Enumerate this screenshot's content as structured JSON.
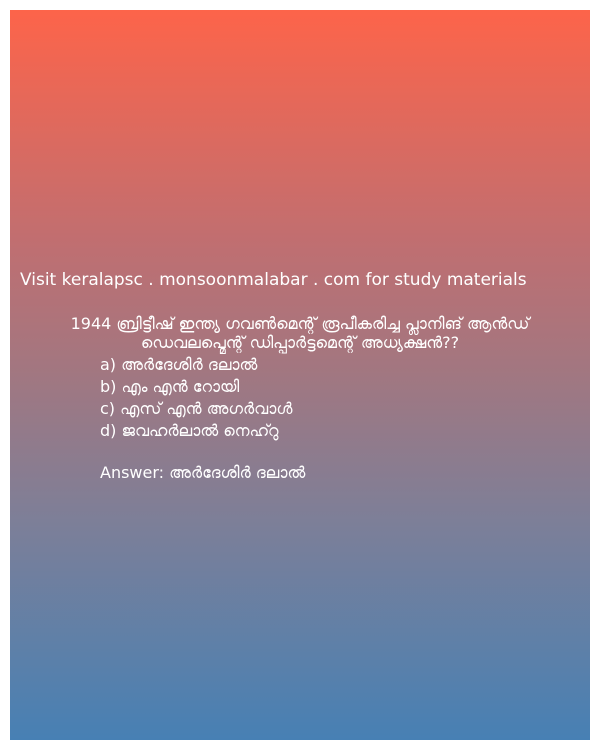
{
  "visit_text": "Visit keralapsc . monsoonmalabar . com for study materials",
  "question": "1944 ബ്രിട്ടീഷ് ഇന്ത്യ ഗവൺമെന്റ് രൂപീകരിച്ച പ്ലാനിങ് ആൻഡ് ഡെവലപ്മെന്റ് ഡിപ്പാർട്ടമെന്റ് അധ്യക്ഷൻ??",
  "options": [
    "a) അർദേശിർ ദലാൽ",
    "b) എം എൻ റോയി",
    "c) എസ് എൻ അഗർവാൾ",
    "d) ജവഹർലാൽ നെഹ്റു"
  ],
  "answer": "Answer: അർദേശിർ ദലാൽ",
  "colors": {
    "gradient_top": "#fd644a",
    "gradient_bottom": "#4780b4",
    "text": "#ffffff"
  }
}
